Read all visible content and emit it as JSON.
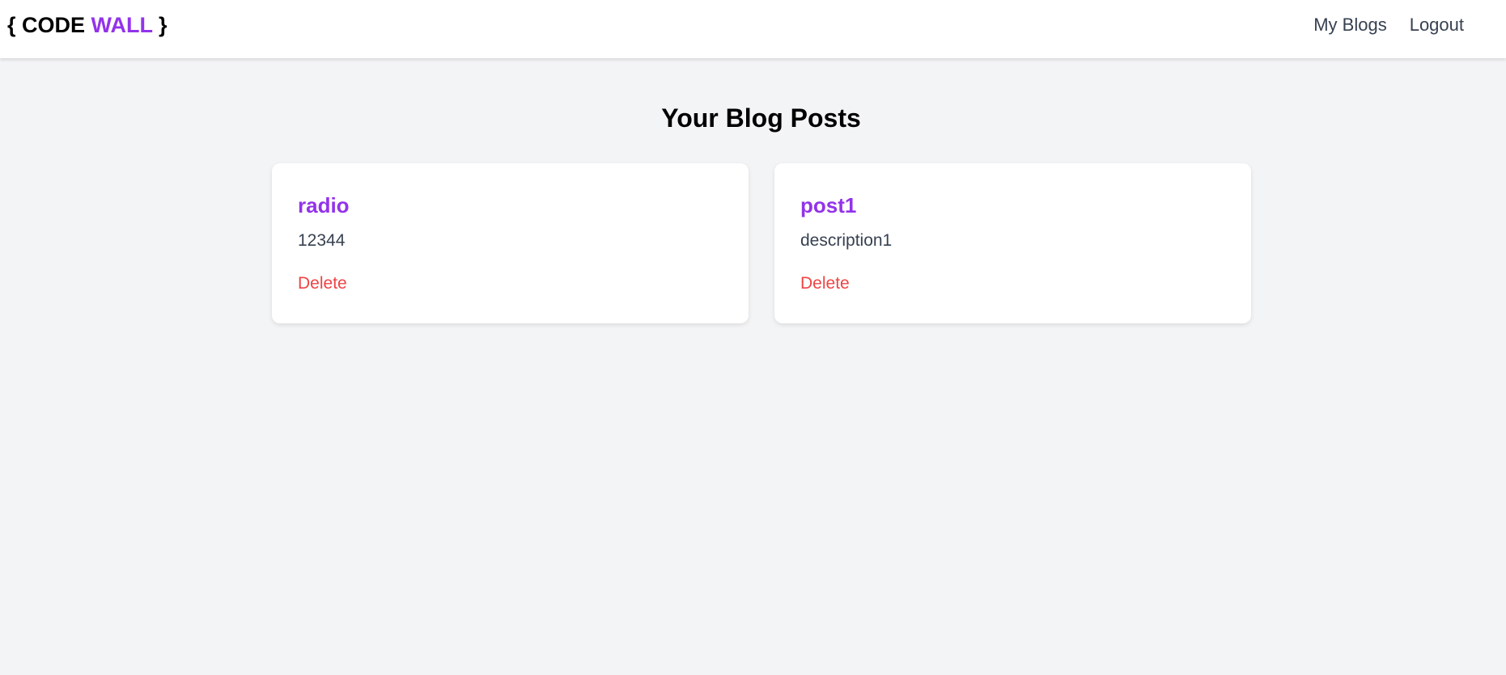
{
  "header": {
    "logo": {
      "open_brace": "{ ",
      "code": "CODE ",
      "wall": "WALL",
      "close_brace": " }"
    },
    "nav": [
      {
        "label": "My Blogs"
      },
      {
        "label": "Logout"
      }
    ]
  },
  "main": {
    "title": "Your Blog Posts",
    "posts": [
      {
        "title": "radio",
        "description": "12344",
        "delete_label": "Delete"
      },
      {
        "title": "post1",
        "description": "description1",
        "delete_label": "Delete"
      }
    ]
  },
  "colors": {
    "accent": "#9333ea",
    "danger": "#ef4444",
    "background": "#f3f4f6"
  }
}
